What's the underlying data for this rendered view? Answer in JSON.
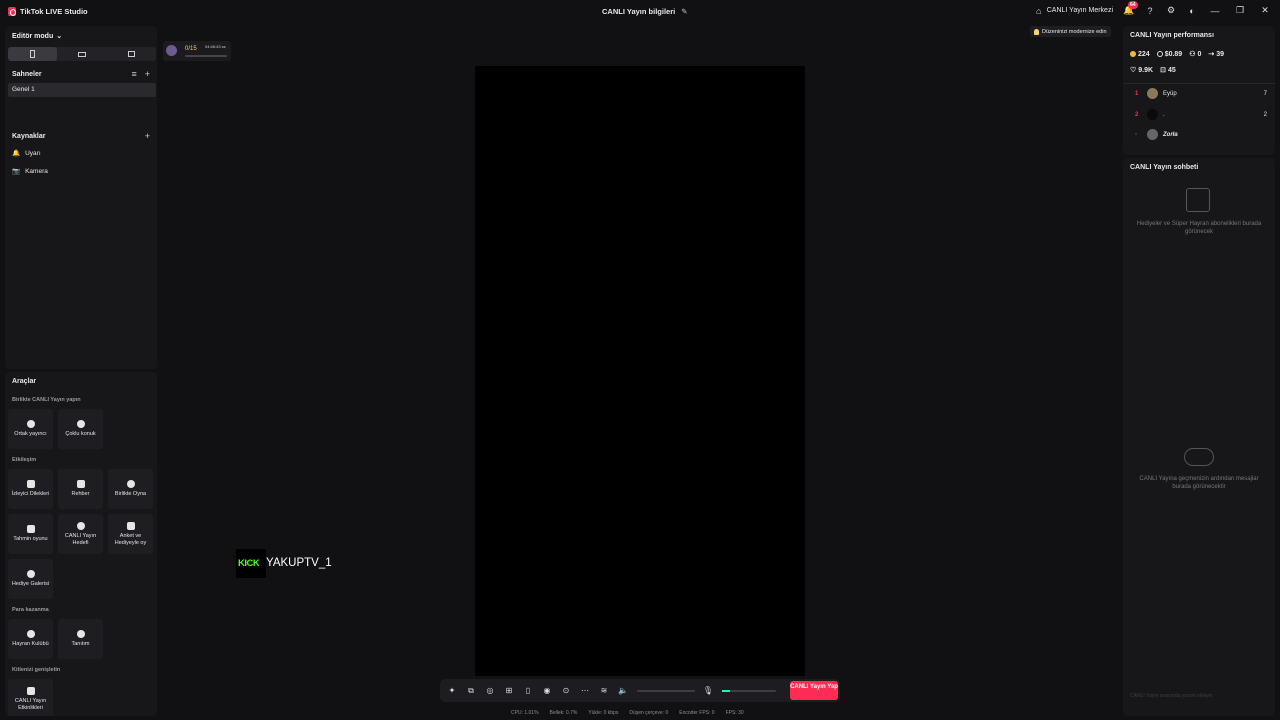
{
  "titlebar": {
    "app_name": "TikTok LIVE Studio",
    "stream_info": "CANLI Yayın bilgileri",
    "live_center": "CANLI Yayın Merkezi",
    "notification_count": "64"
  },
  "left": {
    "editor_mode": "Editör modu",
    "scenes_title": "Sahneler",
    "scene": "Genel 1",
    "sources_title": "Kaynaklar",
    "sources": [
      "Uyarı",
      "Kamera"
    ]
  },
  "tools": {
    "title": "Araçlar",
    "groups": {
      "collab": "Birlikte CANLI Yayın yapın",
      "engagement": "Etkileşim",
      "monetize": "Para kazanma",
      "expand": "Kitlenizi genişletin"
    },
    "items": {
      "co_host": "Ortak yayıncı",
      "multi_guest": "Çoklu konuk",
      "viewer_requests": "İzleyici Dilekleri",
      "guide": "Rehber",
      "play_together": "Birlikte Oyna",
      "prediction": "Tahmin oyunu",
      "live_goal": "CANLI Yayın Hedefi",
      "poll": "Anket ve Hediyeyle oy",
      "gift_gallery": "Hediye Galerisi",
      "fan_club": "Hayran Kulübü",
      "promote": "Tanıtım",
      "live_events": "CANLI Yayın Etkinlikleri"
    }
  },
  "canvas": {
    "goal_count": "0/15",
    "goal_time": "04:46:43 ss",
    "kick_logo": "KICK",
    "kick_name": "YAKUPTV_1",
    "hint": "Düzeninizi modernize edin"
  },
  "controls": {
    "go_live": "CANLI Yayın Yap",
    "status": [
      "CPU: 1.01%",
      "Bellek: 0.7%",
      "Yükle: 0 kbps",
      "Düşen çerçeve: 0",
      "Encoder FPS: 0",
      "FPS: 30"
    ]
  },
  "performance": {
    "title": "CANLI Yayın performansı",
    "diamonds": "224",
    "earnings": "$0.89",
    "new_followers": "0",
    "shares": "39",
    "likes": "9.9K",
    "gifters": "45",
    "ranking": [
      {
        "rank": "1",
        "name": "Eyüp",
        "score": "7"
      },
      {
        "rank": "2",
        "name": ".",
        "score": "2"
      },
      {
        "rank": "-",
        "name": "Zorła",
        "score": ""
      }
    ]
  },
  "chat": {
    "title": "CANLI Yayın sohbeti",
    "gifts_empty": "Hediyeler ve Süper Hayran abonelikleri burada görünecek",
    "messages_empty": "CANLI Yayına geçmenizin ardından mesajlar burada görünecektir",
    "input_placeholder": "CANLI Yayın sırasında yorum ekleyin"
  },
  "colors": {
    "accent": "#fe2c55",
    "kick_green": "#53fc18",
    "mic_level": "#25f4ac"
  }
}
